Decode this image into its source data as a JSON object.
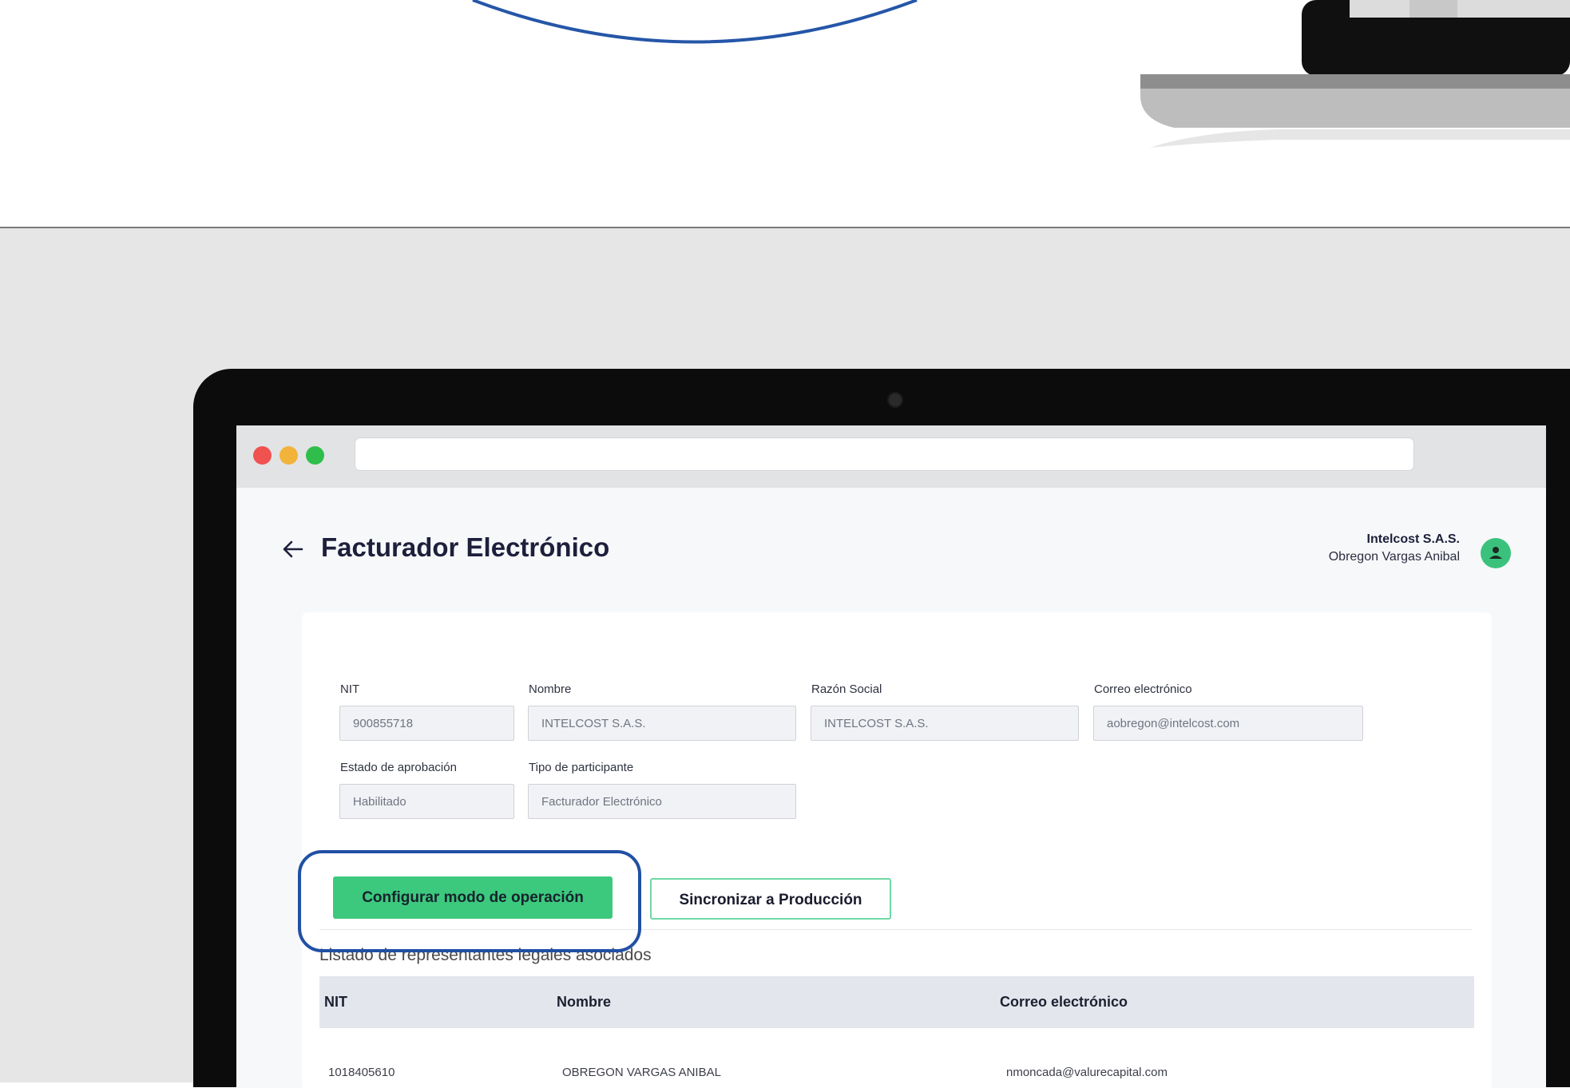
{
  "title": "Facturador Electrónico",
  "header": {
    "company": "Intelcost S.A.S.",
    "user": "Obregon Vargas Anibal"
  },
  "fields": {
    "nit": {
      "label": "NIT",
      "value": "900855718"
    },
    "nombre": {
      "label": "Nombre",
      "value": "INTELCOST S.A.S."
    },
    "razon_social": {
      "label": "Razón Social",
      "value": "INTELCOST S.A.S."
    },
    "correo": {
      "label": "Correo electrónico",
      "value": "aobregon@intelcost.com"
    },
    "estado": {
      "label": "Estado de aprobación",
      "value": "Habilitado"
    },
    "tipo": {
      "label": "Tipo de participante",
      "value": "Facturador Electrónico"
    }
  },
  "buttons": {
    "configurar": "Configurar modo de operación",
    "sincronizar": "Sincronizar a Producción"
  },
  "list_caption": "Listado de representantes legales asociados",
  "table": {
    "headers": [
      "NIT",
      "Nombre",
      "Correo electrónico"
    ],
    "rows": [
      [
        "1018405610",
        "OBREGON VARGAS ANIBAL",
        "nmoncada@valurecapital.com"
      ]
    ]
  },
  "colors": {
    "accent_green": "#3cc97d",
    "highlight_blue": "#2150a4",
    "title": "#1d1f3b"
  }
}
